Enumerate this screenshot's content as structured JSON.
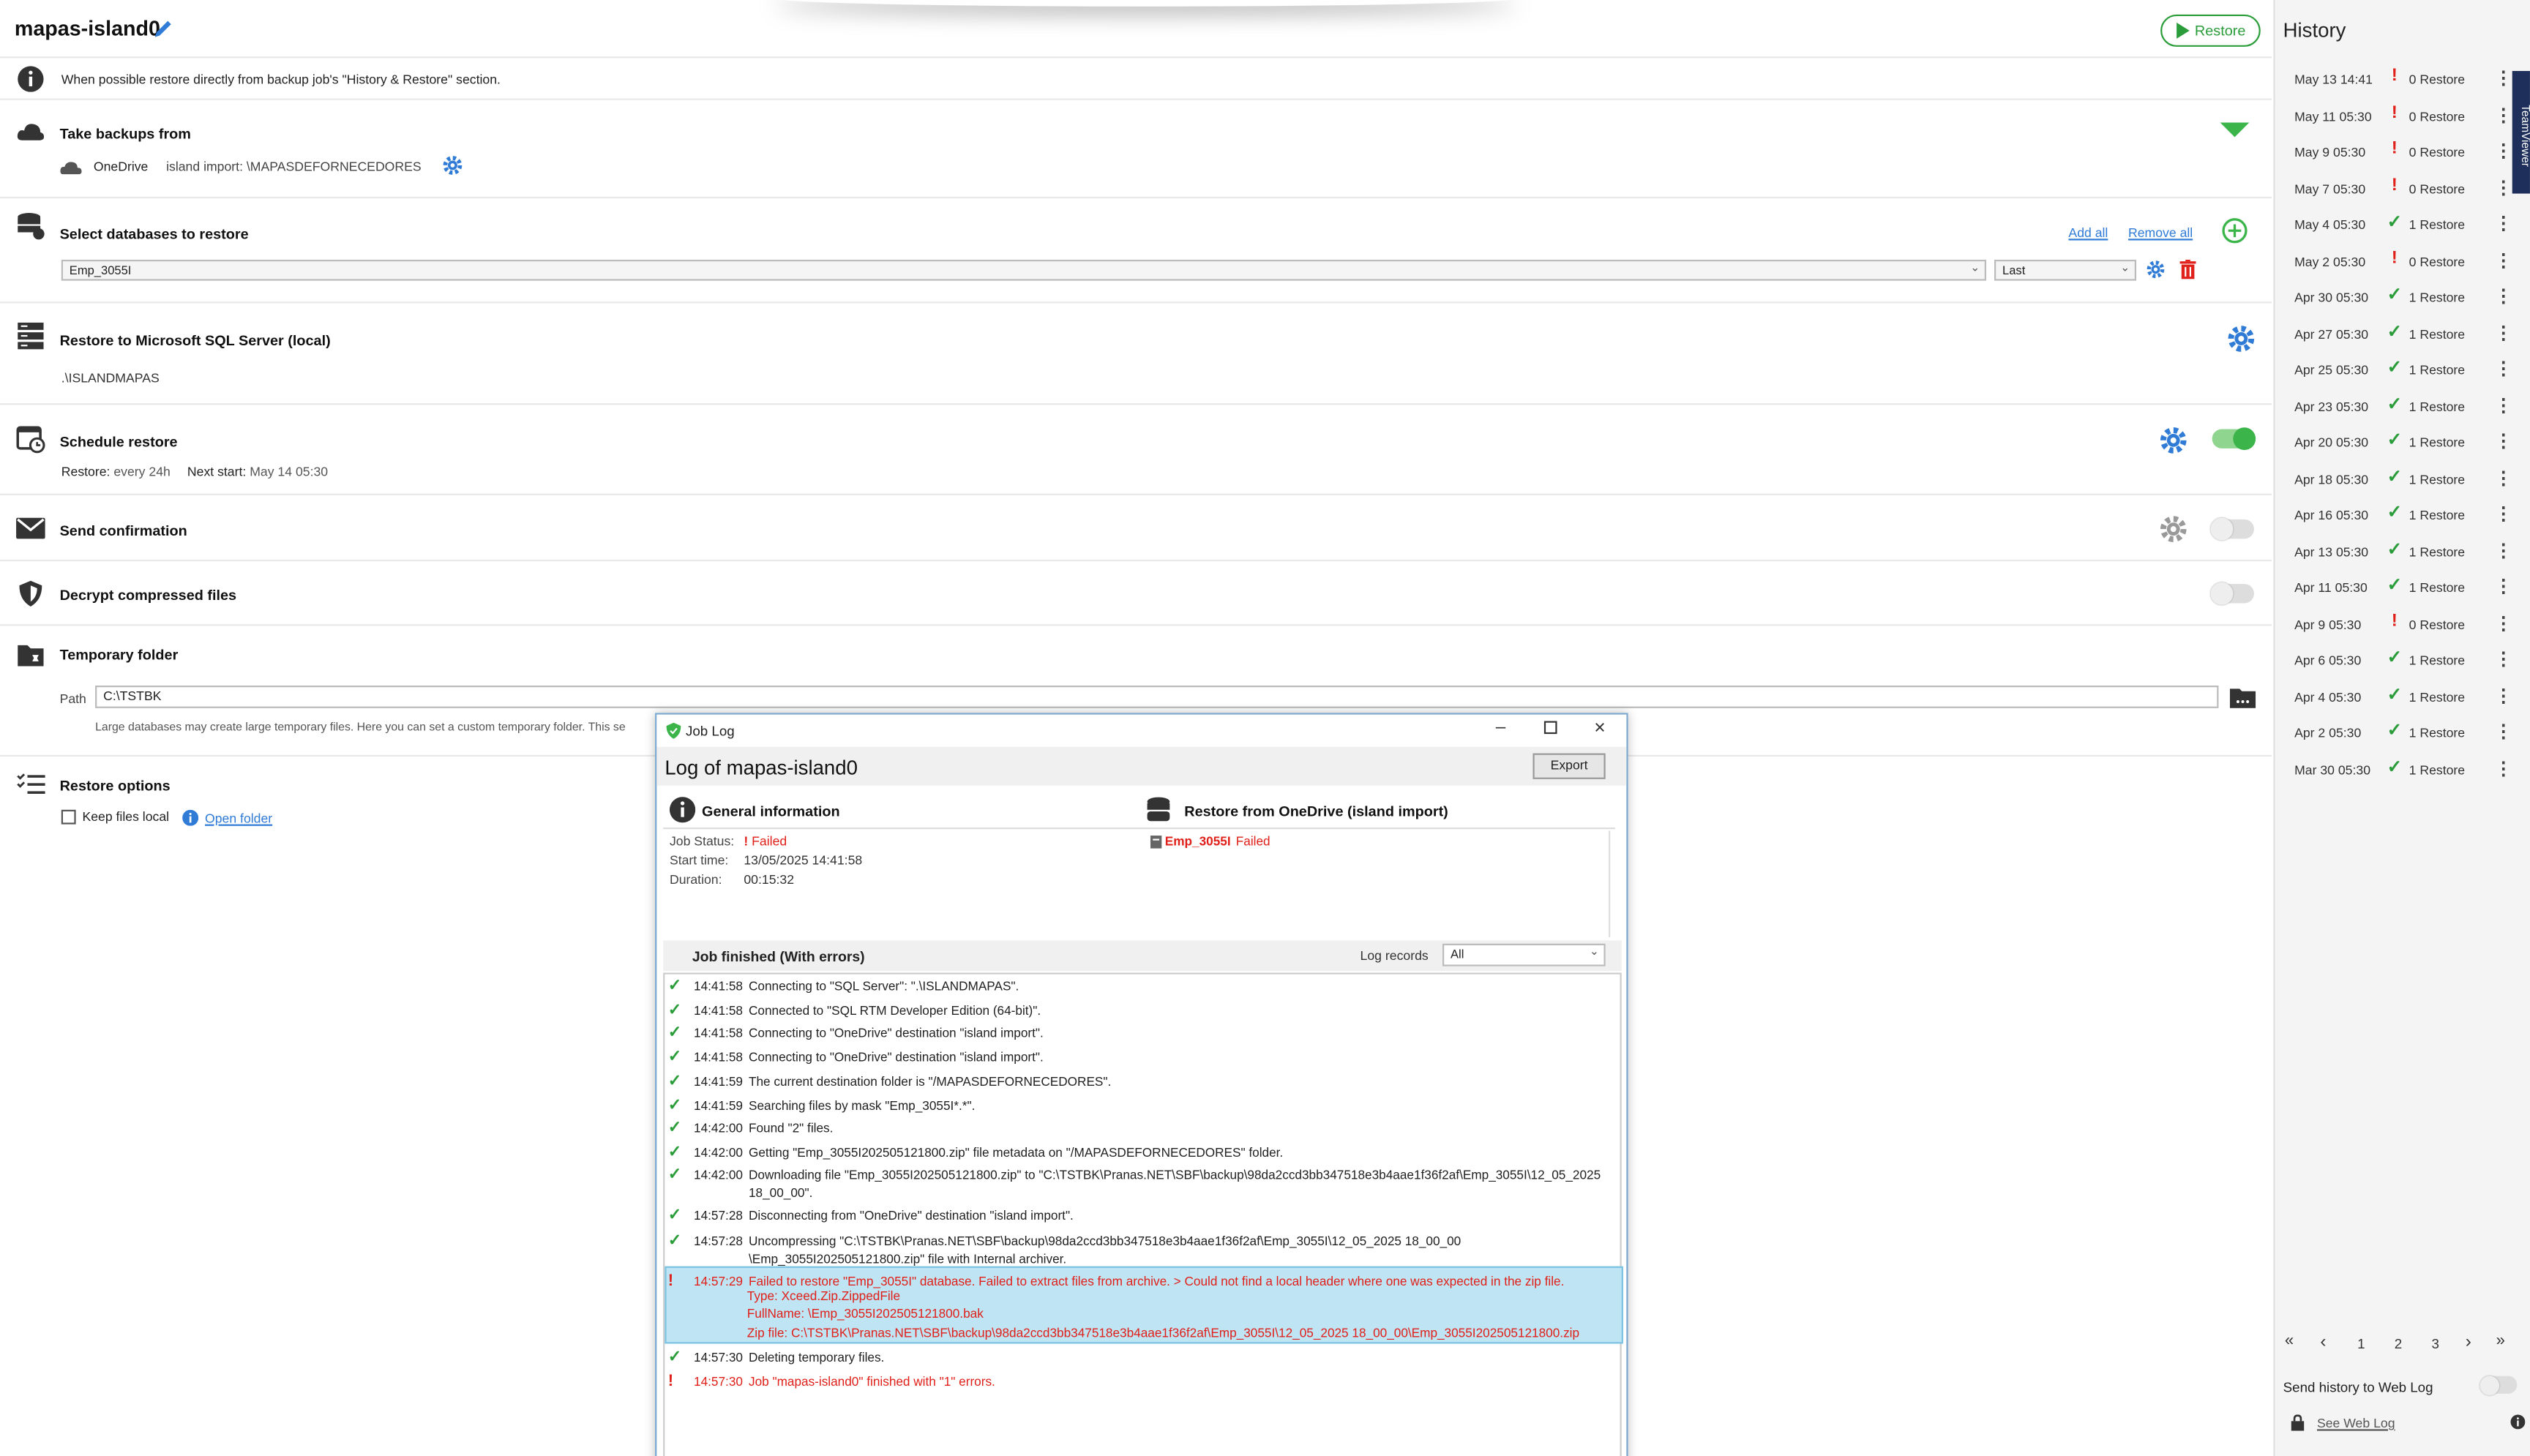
{
  "header": {
    "title": "mapas-island0",
    "restore_label": "Restore"
  },
  "info": {
    "text": "When possible restore directly from backup job's \"History & Restore\" section."
  },
  "backups_from": {
    "title": "Take backups from",
    "service": "OneDrive",
    "detail": "island import: \\MAPASDEFORNECEDORES"
  },
  "databases": {
    "title": "Select databases to restore",
    "add_all": "Add all",
    "remove_all": "Remove all",
    "db_value": "Emp_3055I",
    "version_value": "Last"
  },
  "restore_to": {
    "title": "Restore to Microsoft SQL Server (local)",
    "server": ".\\ISLANDMAPAS"
  },
  "schedule": {
    "title": "Schedule restore",
    "restore_label": "Restore:",
    "restore_value": "every 24h",
    "next_label": "Next start:",
    "next_value": "May 14 05:30"
  },
  "confirmation": {
    "title": "Send confirmation"
  },
  "decrypt": {
    "title": "Decrypt compressed files"
  },
  "temp_folder": {
    "title": "Temporary folder",
    "path_label": "Path",
    "path_value": "C:\\TSTBK",
    "hint": "Large databases may create large temporary files. Here you can set a custom temporary folder. This se"
  },
  "restore_options": {
    "title": "Restore options",
    "keep_local": "Keep files local",
    "open_folder": "Open folder"
  },
  "history": {
    "title": "History",
    "rows": [
      {
        "date": "May 13 14:41",
        "status": "fail",
        "result": "0 Restore"
      },
      {
        "date": "May 11 05:30",
        "status": "fail",
        "result": "0 Restore"
      },
      {
        "date": "May 9 05:30",
        "status": "fail",
        "result": "0 Restore"
      },
      {
        "date": "May 7 05:30",
        "status": "fail",
        "result": "0 Restore"
      },
      {
        "date": "May 4 05:30",
        "status": "ok",
        "result": "1 Restore"
      },
      {
        "date": "May 2 05:30",
        "status": "fail",
        "result": "0 Restore"
      },
      {
        "date": "Apr 30 05:30",
        "status": "ok",
        "result": "1 Restore"
      },
      {
        "date": "Apr 27 05:30",
        "status": "ok",
        "result": "1 Restore"
      },
      {
        "date": "Apr 25 05:30",
        "status": "ok",
        "result": "1 Restore"
      },
      {
        "date": "Apr 23 05:30",
        "status": "ok",
        "result": "1 Restore"
      },
      {
        "date": "Apr 20 05:30",
        "status": "ok",
        "result": "1 Restore"
      },
      {
        "date": "Apr 18 05:30",
        "status": "ok",
        "result": "1 Restore"
      },
      {
        "date": "Apr 16 05:30",
        "status": "ok",
        "result": "1 Restore"
      },
      {
        "date": "Apr 13 05:30",
        "status": "ok",
        "result": "1 Restore"
      },
      {
        "date": "Apr 11 05:30",
        "status": "ok",
        "result": "1 Restore"
      },
      {
        "date": "Apr 9 05:30",
        "status": "fail",
        "result": "0 Restore"
      },
      {
        "date": "Apr 6 05:30",
        "status": "ok",
        "result": "1 Restore"
      },
      {
        "date": "Apr 4 05:30",
        "status": "ok",
        "result": "1 Restore"
      },
      {
        "date": "Apr 2 05:30",
        "status": "ok",
        "result": "1 Restore"
      },
      {
        "date": "Mar 30 05:30",
        "status": "ok",
        "result": "1 Restore"
      }
    ],
    "pages": [
      "1",
      "2",
      "3"
    ],
    "send_web_log": "Send history to Web Log",
    "see_web_log": "See Web Log",
    "teamviewer": "TeamViewer"
  },
  "joblog": {
    "window_title": "Job Log",
    "heading_prefix": "Log of",
    "heading_name": "mapas-island0",
    "export_label": "Export",
    "general_title": "General information",
    "status_label": "Job Status:",
    "status_value": "Failed",
    "start_label": "Start time:",
    "start_value": "13/05/2025 14:41:58",
    "duration_label": "Duration:",
    "duration_value": "00:15:32",
    "restore_from_title": "Restore from OneDrive (island import)",
    "db_name": "Emp_3055I",
    "db_status": "Failed",
    "finished_title": "Job finished (With errors)",
    "log_records_label": "Log records",
    "log_records_value": "All",
    "lines": [
      {
        "s": "ok",
        "t": "14:41:58",
        "m": "Connecting to \"SQL Server\": \".\\ISLANDMAPAS\"."
      },
      {
        "s": "ok",
        "t": "14:41:58",
        "m": "Connected to \"SQL RTM Developer Edition (64-bit)\"."
      },
      {
        "s": "ok",
        "t": "14:41:58",
        "m": "Connecting to \"OneDrive\" destination \"island import\"."
      },
      {
        "s": "ok",
        "t": "14:41:58",
        "m": "Connecting to \"OneDrive\" destination \"island import\"."
      },
      {
        "s": "ok",
        "t": "14:41:59",
        "m": "The current destination folder is \"/MAPASDEFORNECEDORES\"."
      },
      {
        "s": "ok",
        "t": "14:41:59",
        "m": "Searching files by mask \"Emp_3055I*.*\"."
      },
      {
        "s": "ok",
        "t": "14:42:00",
        "m": "Found \"2\" files."
      },
      {
        "s": "ok",
        "t": "14:42:00",
        "m": "Getting \"Emp_3055I202505121800.zip\" file metadata on \"/MAPASDEFORNECEDORES\" folder."
      },
      {
        "s": "ok",
        "t": "14:42:00",
        "m": "Downloading file \"Emp_3055I202505121800.zip\" to \"C:\\TSTBK\\Pranas.NET\\SBF\\backup\\98da2ccd3bb347518e3b4aae1f36f2af\\Emp_3055I\\12_05_2025 18_00_00\"."
      },
      {
        "s": "ok",
        "t": "14:57:28",
        "m": "Disconnecting from \"OneDrive\" destination \"island import\"."
      },
      {
        "s": "ok",
        "t": "14:57:28",
        "m": "Uncompressing \"C:\\TSTBK\\Pranas.NET\\SBF\\backup\\98da2ccd3bb347518e3b4aae1f36f2af\\Emp_3055I\\12_05_2025 18_00_00 \\Emp_3055I202505121800.zip\" file with Internal archiver."
      },
      {
        "s": "err",
        "t": "14:57:29",
        "m": "Failed to restore \"Emp_3055I\" database. Failed to extract files from archive. > Could not find a local header where one was expected in the zip file."
      },
      {
        "s": "ok",
        "t": "14:57:30",
        "m": "Deleting temporary files."
      },
      {
        "s": "err",
        "t": "14:57:30",
        "m": "Job \"mapas-island0\" finished with \"1\" errors."
      }
    ],
    "err_detail_1": "Type: Xceed.Zip.ZippedFile",
    "err_detail_2": "FullName: \\Emp_3055I202505121800.bak",
    "err_detail_3": "Zip file: C:\\TSTBK\\Pranas.NET\\SBF\\backup\\98da2ccd3bb347518e3b4aae1f36f2af\\Emp_3055I\\12_05_2025 18_00_00\\Emp_3055I202505121800.zip"
  }
}
